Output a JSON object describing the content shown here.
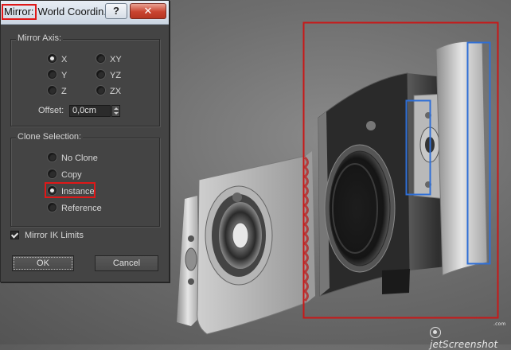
{
  "dialog": {
    "title_prefix": "Mirror:",
    "title_rest": "World Coordin...",
    "help_label": "?",
    "close_label": "✕",
    "mirror_axis": {
      "label": "Mirror Axis:",
      "options": [
        {
          "label": "X",
          "selected": true
        },
        {
          "label": "Y",
          "selected": false
        },
        {
          "label": "Z",
          "selected": false
        },
        {
          "label": "XY",
          "selected": false
        },
        {
          "label": "YZ",
          "selected": false
        },
        {
          "label": "ZX",
          "selected": false
        }
      ],
      "offset_label": "Offset:",
      "offset_value": "0,0cm"
    },
    "clone_selection": {
      "label": "Clone Selection:",
      "options": [
        {
          "label": "No Clone",
          "selected": false
        },
        {
          "label": "Copy",
          "selected": false
        },
        {
          "label": "Instance",
          "selected": true
        },
        {
          "label": "Reference",
          "selected": false
        }
      ]
    },
    "mirror_ik": {
      "label": "Mirror IK Limits",
      "checked": true
    },
    "ok_label": "OK",
    "cancel_label": "Cancel"
  },
  "viewport": {
    "watermark": "jetScreenshot",
    "watermark_suffix": ".com"
  },
  "colors": {
    "highlight_red": "#e01818",
    "selection_red": "#c81818",
    "selection_blue": "#2f6fd6",
    "dialog_bg": "#444444",
    "viewport_bg": "#707070"
  }
}
